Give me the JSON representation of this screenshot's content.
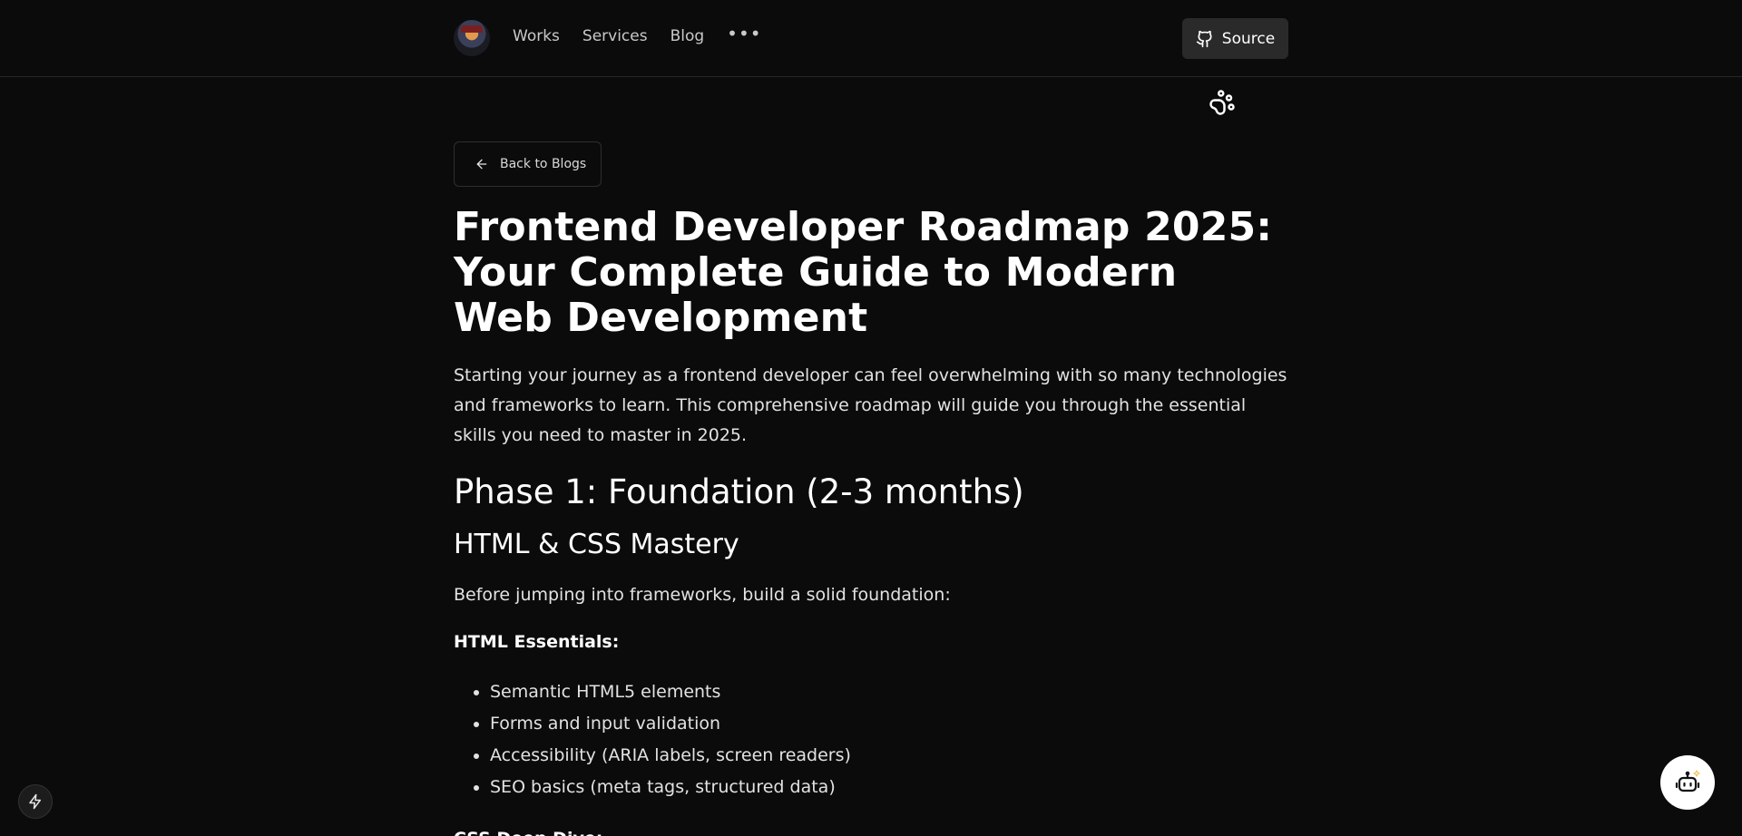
{
  "nav": {
    "items": [
      {
        "label": "Works"
      },
      {
        "label": "Services"
      },
      {
        "label": "Blog"
      }
    ],
    "more": "•••",
    "source_label": "Source"
  },
  "back_label": "Back to Blogs",
  "article": {
    "title": "Frontend Developer Roadmap 2025: Your Complete Guide to Modern Web Development",
    "intro": "Starting your journey as a frontend developer can feel overwhelming with so many technologies and frameworks to learn. This comprehensive roadmap will guide you through the essential skills you need to master in 2025.",
    "phase_heading": "Phase 1: Foundation (2-3 months)",
    "section_heading": "HTML & CSS Mastery",
    "lead": "Before jumping into frameworks, build a solid foundation:",
    "html_heading": "HTML Essentials:",
    "html_items": [
      "Semantic HTML5 elements",
      "Forms and input validation",
      "Accessibility (ARIA labels, screen readers)",
      "SEO basics (meta tags, structured data)"
    ],
    "css_heading": "CSS Deep Dive:"
  },
  "icons": {
    "source": "github-icon",
    "paw": "paw-icon",
    "back": "arrow-left-icon",
    "bolt": "lightning-icon",
    "bot": "robot-icon"
  }
}
